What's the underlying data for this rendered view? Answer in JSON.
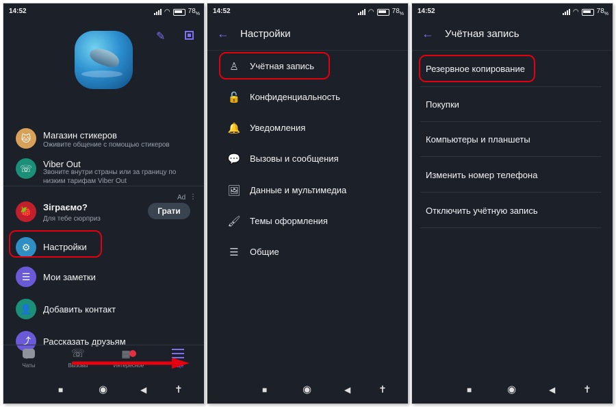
{
  "status": {
    "time": "14:52",
    "battery": "78"
  },
  "screen1": {
    "menu": [
      {
        "title": "Магазин стикеров",
        "subtitle": "Оживите общение с помощью стикеров"
      },
      {
        "title": "Viber Out",
        "subtitle_line1": "Звоните внутри страны или за границу по",
        "subtitle_line2": "низким тарифам Viber Out"
      }
    ],
    "ad": {
      "label": "Ad",
      "title": "Зіграємо?",
      "subtitle": "Для тебе сюрприз",
      "button": "Грати"
    },
    "items": [
      "Настройки",
      "Мои заметки",
      "Добавить контакт",
      "Рассказать друзьям"
    ],
    "tabs": [
      "Чаты",
      "Вызовы",
      "Интересное",
      "Ещё"
    ],
    "colors": {
      "accent": "#7c6ff2",
      "highlight": "#e3000f",
      "bg": "#1b2029"
    }
  },
  "screen2": {
    "title": "Настройки",
    "items": [
      "Учётная запись",
      "Конфиденциальность",
      "Уведомления",
      "Вызовы и сообщения",
      "Данные и мультимедиа",
      "Темы оформления",
      "Общие"
    ]
  },
  "screen3": {
    "title": "Учётная запись",
    "items": [
      "Резервное копирование",
      "Покупки",
      "Компьютеры и планшеты",
      "Изменить номер телефона",
      "Отключить учётную запись"
    ]
  }
}
